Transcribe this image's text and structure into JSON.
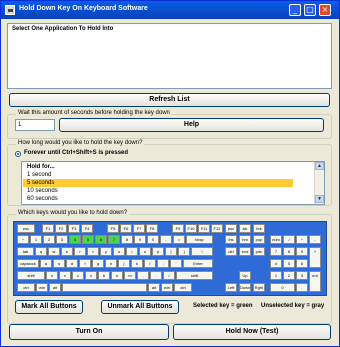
{
  "window": {
    "title": "Hold Down Key On Keyboard Software",
    "controls": [
      "_",
      "□",
      "×"
    ]
  },
  "app_list": {
    "header": "Select One Application To Hold Into",
    "refresh_label": "Refresh List"
  },
  "wait": {
    "label": "Wait this amount of seconds before holding the key down",
    "value": "1",
    "help_label": "Help"
  },
  "duration": {
    "label": "How long would you like to hold the key down?",
    "forever_label": "Forever until Ctrl+Shift+S is pressed",
    "options": [
      "Hold for...",
      "1 second",
      "5 seconds",
      "10 seconds",
      "60 seconds"
    ],
    "selected_index": 2
  },
  "keyboard": {
    "label": "Which keys would you like to hold down?",
    "rows": [
      [
        "esc",
        "F1",
        "F2",
        "F3",
        "F4",
        "F5",
        "F6",
        "F7",
        "F8",
        "F9",
        "F10",
        "F11",
        "F12",
        "psc",
        "slk",
        "brk"
      ],
      [
        "~",
        "1",
        "2",
        "3",
        "4",
        "5",
        "6",
        "7",
        "8",
        "9",
        "0",
        "-",
        "=",
        "bksp",
        "ins",
        "hm",
        "pup",
        "num",
        "/",
        "*",
        "-"
      ],
      [
        "tab",
        "q",
        "w",
        "e",
        "r",
        "t",
        "y",
        "u",
        "i",
        "o",
        "p",
        "[",
        "]",
        "\\",
        "del",
        "end",
        "pdn",
        "7",
        "8",
        "9",
        "+"
      ],
      [
        "capslock",
        "a",
        "s",
        "d",
        "f",
        "g",
        "h",
        "j",
        "k",
        "l",
        ";",
        "'",
        "Enter",
        "4",
        "5",
        "6"
      ],
      [
        "shift",
        "z",
        "x",
        "c",
        "v",
        "b",
        "n",
        "m",
        ",",
        ".",
        "/",
        "shift",
        "Up",
        "1",
        "2",
        "3",
        "ent"
      ],
      [
        "ctrl",
        "win",
        "alt",
        "",
        "alt",
        "win",
        "ctrl",
        "Left",
        "Down",
        "Rght",
        "0",
        "."
      ]
    ],
    "selected_keys": [
      "4",
      "5",
      "6",
      "7"
    ]
  },
  "buttons": {
    "mark_all": "Mark All Buttons",
    "unmark_all": "Unmark All Buttons",
    "turn_on": "Turn On",
    "hold_now": "Hold Now (Test)"
  },
  "legend": {
    "selected": "Selected key = green",
    "unselected": "Unselected key = gray"
  },
  "colors": {
    "titlebar": "#0842b8",
    "selected_key": "#4cd44c",
    "list_highlight": "#ffcc33",
    "keyboard_bg": "#2e6bd6"
  }
}
